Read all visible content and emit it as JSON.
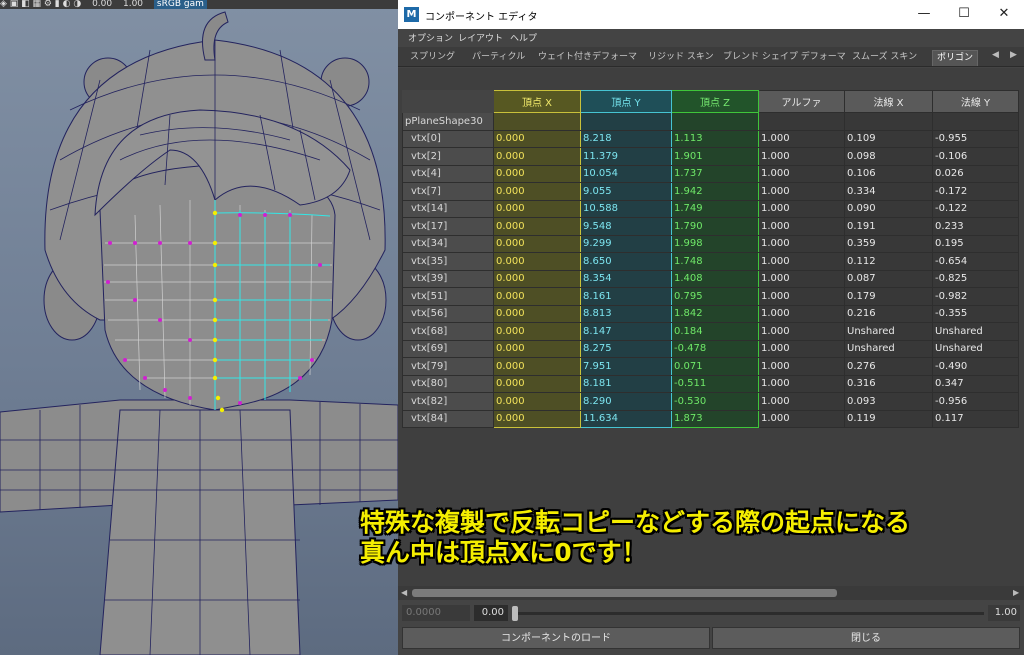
{
  "viewport": {
    "toolbar": {
      "value_a": "0.00",
      "value_b": "1.00",
      "colorspace": "sRGB gam"
    }
  },
  "editor": {
    "title": "コンポーネント エディタ",
    "logo": "M",
    "window_buttons": {
      "minimize": "—",
      "maximize": "☐",
      "close": "✕"
    },
    "menu": [
      "オプション",
      "レイアウト",
      "ヘルプ"
    ],
    "tabs": [
      "スプリング",
      "パーティクル",
      "ウェイト付きデフォーマ",
      "リジッド スキン",
      "ブレンド シェイプ デフォーマ",
      "スムーズ スキン",
      "ポリゴン"
    ],
    "active_tab": "ポリゴン",
    "columns": [
      "頂点 X",
      "頂点 Y",
      "頂点 Z",
      "アルファ",
      "法線 X",
      "法線 Y"
    ],
    "object_name": "pPlaneShape30",
    "rows": [
      {
        "name": "vtx[0]",
        "x": "0.000",
        "y": "8.218",
        "z": "1.113",
        "a": "1.000",
        "nx": "0.109",
        "ny": "-0.955"
      },
      {
        "name": "vtx[2]",
        "x": "0.000",
        "y": "11.379",
        "z": "1.901",
        "a": "1.000",
        "nx": "0.098",
        "ny": "-0.106"
      },
      {
        "name": "vtx[4]",
        "x": "0.000",
        "y": "10.054",
        "z": "1.737",
        "a": "1.000",
        "nx": "0.106",
        "ny": "0.026"
      },
      {
        "name": "vtx[7]",
        "x": "0.000",
        "y": "9.055",
        "z": "1.942",
        "a": "1.000",
        "nx": "0.334",
        "ny": "-0.172"
      },
      {
        "name": "vtx[14]",
        "x": "0.000",
        "y": "10.588",
        "z": "1.749",
        "a": "1.000",
        "nx": "0.090",
        "ny": "-0.122"
      },
      {
        "name": "vtx[17]",
        "x": "0.000",
        "y": "9.548",
        "z": "1.790",
        "a": "1.000",
        "nx": "0.191",
        "ny": "0.233"
      },
      {
        "name": "vtx[34]",
        "x": "0.000",
        "y": "9.299",
        "z": "1.998",
        "a": "1.000",
        "nx": "0.359",
        "ny": "0.195"
      },
      {
        "name": "vtx[35]",
        "x": "0.000",
        "y": "8.650",
        "z": "1.748",
        "a": "1.000",
        "nx": "0.112",
        "ny": "-0.654"
      },
      {
        "name": "vtx[39]",
        "x": "0.000",
        "y": "8.354",
        "z": "1.408",
        "a": "1.000",
        "nx": "0.087",
        "ny": "-0.825"
      },
      {
        "name": "vtx[51]",
        "x": "0.000",
        "y": "8.161",
        "z": "0.795",
        "a": "1.000",
        "nx": "0.179",
        "ny": "-0.982"
      },
      {
        "name": "vtx[56]",
        "x": "0.000",
        "y": "8.813",
        "z": "1.842",
        "a": "1.000",
        "nx": "0.216",
        "ny": "-0.355"
      },
      {
        "name": "vtx[68]",
        "x": "0.000",
        "y": "8.147",
        "z": "0.184",
        "a": "1.000",
        "nx": "Unshared",
        "ny": "Unshared"
      },
      {
        "name": "vtx[69]",
        "x": "0.000",
        "y": "8.275",
        "z": "-0.478",
        "a": "1.000",
        "nx": "Unshared",
        "ny": "Unshared"
      },
      {
        "name": "vtx[79]",
        "x": "0.000",
        "y": "7.951",
        "z": "0.071",
        "a": "1.000",
        "nx": "0.276",
        "ny": "-0.490"
      },
      {
        "name": "vtx[80]",
        "x": "0.000",
        "y": "8.181",
        "z": "-0.511",
        "a": "1.000",
        "nx": "0.316",
        "ny": "0.347"
      },
      {
        "name": "vtx[82]",
        "x": "0.000",
        "y": "8.290",
        "z": "-0.530",
        "a": "1.000",
        "nx": "0.093",
        "ny": "-0.956"
      },
      {
        "name": "vtx[84]",
        "x": "0.000",
        "y": "11.634",
        "z": "1.873",
        "a": "1.000",
        "nx": "0.119",
        "ny": "0.117"
      }
    ],
    "slider": {
      "min": "0.0000",
      "value": "0.00",
      "max": "1.00"
    },
    "buttons": {
      "load": "コンポーネントのロード",
      "close": "閉じる"
    }
  },
  "caption": {
    "line1": "特殊な複製で反転コピーなどする際の起点になる",
    "line2": "真ん中は頂点Xに0です！"
  },
  "colors": {
    "vertex_x": "#f2e25a",
    "vertex_y": "#7ce4ef",
    "vertex_z": "#6fe868",
    "caption": "#f5ee00"
  }
}
